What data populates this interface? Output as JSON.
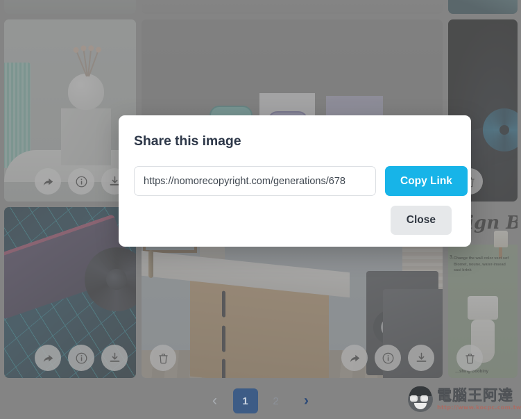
{
  "modal": {
    "title": "Share this image",
    "link_value": "https://nomorecopyright.com/generations/678",
    "link_placeholder": "https://nomorecopyright.com/generations/678",
    "copy_label": "Copy Link",
    "close_label": "Close",
    "copy_color": "#17b4e8",
    "close_color": "#e6e8ea"
  },
  "pagination": {
    "prev": "‹",
    "next": "›",
    "pages": [
      "1",
      "2"
    ],
    "active_page": "1",
    "active_color": "#3d5c86"
  },
  "gallery": {
    "top_strip": [
      {
        "name": "strip-card-1"
      },
      {
        "name": "strip-card-2"
      },
      {
        "name": "strip-card-3"
      }
    ],
    "cards": [
      {
        "name": "card-plant-shelf",
        "art": "plant",
        "actions": [
          "share-icon",
          "info-icon",
          "download-icon"
        ],
        "actions_side": "right"
      },
      {
        "name": "card-smartphones",
        "art": "phones",
        "actions": [],
        "actions_side": "right"
      },
      {
        "name": "card-gpu-dark",
        "art": "gpu-dark",
        "actions": [
          "trash-icon"
        ],
        "actions_side": "left"
      },
      {
        "name": "card-gpu-neon",
        "art": "gpu-neon",
        "actions": [
          "share-icon",
          "info-icon",
          "download-icon"
        ],
        "actions_side": "right"
      },
      {
        "name": "card-laundry-room",
        "art": "bath",
        "actions": [
          "trash-icon"
        ],
        "actions_side": "left"
      },
      {
        "name": "card-design-poster",
        "art": "poster",
        "actions": [
          "trash-icon"
        ],
        "actions_side": "left"
      }
    ],
    "poster": {
      "headline": "esign Brea",
      "step_number": "3.",
      "step_text": "Change the wall color vect sof Blomet, noune, water-insead sasi brink",
      "caption": "…shing Goobiny"
    }
  },
  "watermark": {
    "brand": "電腦王阿達",
    "url": "http://www.kocpc.com.tw"
  }
}
